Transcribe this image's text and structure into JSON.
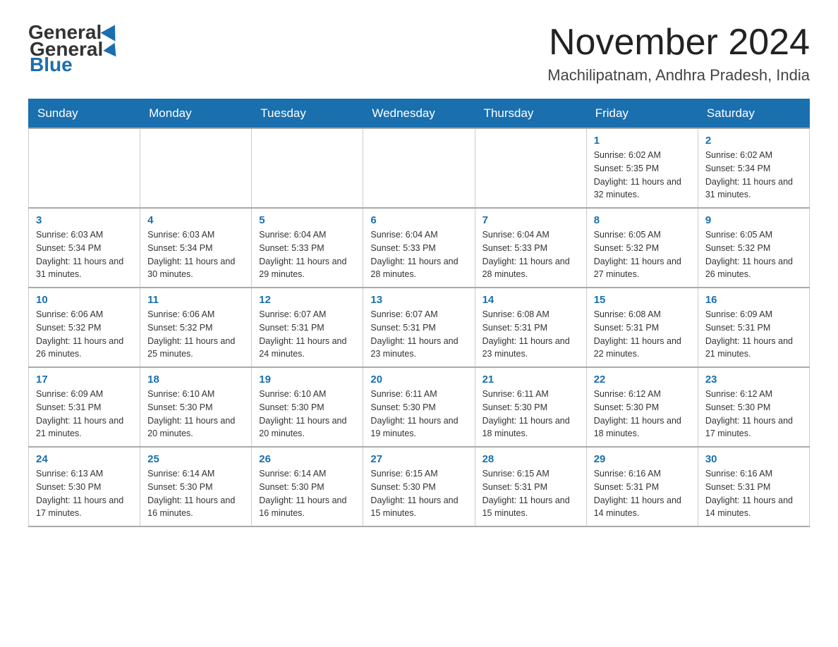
{
  "header": {
    "title": "November 2024",
    "location": "Machilipatnam, Andhra Pradesh, India",
    "logo_general": "General",
    "logo_blue": "Blue"
  },
  "days_header": [
    "Sunday",
    "Monday",
    "Tuesday",
    "Wednesday",
    "Thursday",
    "Friday",
    "Saturday"
  ],
  "weeks": [
    {
      "days": [
        {
          "num": "",
          "info": ""
        },
        {
          "num": "",
          "info": ""
        },
        {
          "num": "",
          "info": ""
        },
        {
          "num": "",
          "info": ""
        },
        {
          "num": "",
          "info": ""
        },
        {
          "num": "1",
          "info": "Sunrise: 6:02 AM\nSunset: 5:35 PM\nDaylight: 11 hours and 32 minutes."
        },
        {
          "num": "2",
          "info": "Sunrise: 6:02 AM\nSunset: 5:34 PM\nDaylight: 11 hours and 31 minutes."
        }
      ]
    },
    {
      "days": [
        {
          "num": "3",
          "info": "Sunrise: 6:03 AM\nSunset: 5:34 PM\nDaylight: 11 hours and 31 minutes."
        },
        {
          "num": "4",
          "info": "Sunrise: 6:03 AM\nSunset: 5:34 PM\nDaylight: 11 hours and 30 minutes."
        },
        {
          "num": "5",
          "info": "Sunrise: 6:04 AM\nSunset: 5:33 PM\nDaylight: 11 hours and 29 minutes."
        },
        {
          "num": "6",
          "info": "Sunrise: 6:04 AM\nSunset: 5:33 PM\nDaylight: 11 hours and 28 minutes."
        },
        {
          "num": "7",
          "info": "Sunrise: 6:04 AM\nSunset: 5:33 PM\nDaylight: 11 hours and 28 minutes."
        },
        {
          "num": "8",
          "info": "Sunrise: 6:05 AM\nSunset: 5:32 PM\nDaylight: 11 hours and 27 minutes."
        },
        {
          "num": "9",
          "info": "Sunrise: 6:05 AM\nSunset: 5:32 PM\nDaylight: 11 hours and 26 minutes."
        }
      ]
    },
    {
      "days": [
        {
          "num": "10",
          "info": "Sunrise: 6:06 AM\nSunset: 5:32 PM\nDaylight: 11 hours and 26 minutes."
        },
        {
          "num": "11",
          "info": "Sunrise: 6:06 AM\nSunset: 5:32 PM\nDaylight: 11 hours and 25 minutes."
        },
        {
          "num": "12",
          "info": "Sunrise: 6:07 AM\nSunset: 5:31 PM\nDaylight: 11 hours and 24 minutes."
        },
        {
          "num": "13",
          "info": "Sunrise: 6:07 AM\nSunset: 5:31 PM\nDaylight: 11 hours and 23 minutes."
        },
        {
          "num": "14",
          "info": "Sunrise: 6:08 AM\nSunset: 5:31 PM\nDaylight: 11 hours and 23 minutes."
        },
        {
          "num": "15",
          "info": "Sunrise: 6:08 AM\nSunset: 5:31 PM\nDaylight: 11 hours and 22 minutes."
        },
        {
          "num": "16",
          "info": "Sunrise: 6:09 AM\nSunset: 5:31 PM\nDaylight: 11 hours and 21 minutes."
        }
      ]
    },
    {
      "days": [
        {
          "num": "17",
          "info": "Sunrise: 6:09 AM\nSunset: 5:31 PM\nDaylight: 11 hours and 21 minutes."
        },
        {
          "num": "18",
          "info": "Sunrise: 6:10 AM\nSunset: 5:30 PM\nDaylight: 11 hours and 20 minutes."
        },
        {
          "num": "19",
          "info": "Sunrise: 6:10 AM\nSunset: 5:30 PM\nDaylight: 11 hours and 20 minutes."
        },
        {
          "num": "20",
          "info": "Sunrise: 6:11 AM\nSunset: 5:30 PM\nDaylight: 11 hours and 19 minutes."
        },
        {
          "num": "21",
          "info": "Sunrise: 6:11 AM\nSunset: 5:30 PM\nDaylight: 11 hours and 18 minutes."
        },
        {
          "num": "22",
          "info": "Sunrise: 6:12 AM\nSunset: 5:30 PM\nDaylight: 11 hours and 18 minutes."
        },
        {
          "num": "23",
          "info": "Sunrise: 6:12 AM\nSunset: 5:30 PM\nDaylight: 11 hours and 17 minutes."
        }
      ]
    },
    {
      "days": [
        {
          "num": "24",
          "info": "Sunrise: 6:13 AM\nSunset: 5:30 PM\nDaylight: 11 hours and 17 minutes."
        },
        {
          "num": "25",
          "info": "Sunrise: 6:14 AM\nSunset: 5:30 PM\nDaylight: 11 hours and 16 minutes."
        },
        {
          "num": "26",
          "info": "Sunrise: 6:14 AM\nSunset: 5:30 PM\nDaylight: 11 hours and 16 minutes."
        },
        {
          "num": "27",
          "info": "Sunrise: 6:15 AM\nSunset: 5:30 PM\nDaylight: 11 hours and 15 minutes."
        },
        {
          "num": "28",
          "info": "Sunrise: 6:15 AM\nSunset: 5:31 PM\nDaylight: 11 hours and 15 minutes."
        },
        {
          "num": "29",
          "info": "Sunrise: 6:16 AM\nSunset: 5:31 PM\nDaylight: 11 hours and 14 minutes."
        },
        {
          "num": "30",
          "info": "Sunrise: 6:16 AM\nSunset: 5:31 PM\nDaylight: 11 hours and 14 minutes."
        }
      ]
    }
  ]
}
